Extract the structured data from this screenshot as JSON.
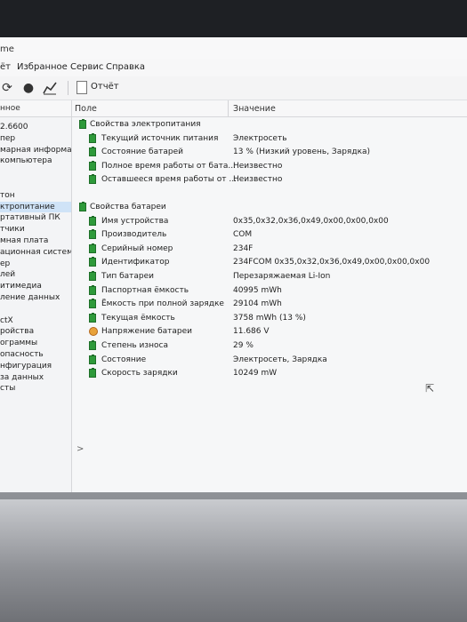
{
  "window": {
    "title_fragment": "me"
  },
  "menu": [
    "ёт",
    "Избранное",
    "Сервис",
    "Справка"
  ],
  "toolbar": {
    "report_label": "Отчёт",
    "icons": [
      "refresh-icon",
      "user-icon",
      "chart-icon"
    ]
  },
  "left_pane": {
    "header": "нное",
    "items": [
      {
        "label": "2.6600",
        "selected": false
      },
      {
        "label": "пер",
        "selected": false
      },
      {
        "label": "марная информац",
        "selected": false
      },
      {
        "label": "компьютера",
        "selected": false
      },
      {
        "label": "",
        "selected": false
      },
      {
        "label": "",
        "selected": false
      },
      {
        "label": "тон",
        "selected": false
      },
      {
        "label": "ктропитание",
        "selected": true
      },
      {
        "label": "ртативный ПК",
        "selected": false
      },
      {
        "label": "тчики",
        "selected": false
      },
      {
        "label": "мная плата",
        "selected": false
      },
      {
        "label": "ационная система",
        "selected": false
      },
      {
        "label": "ер",
        "selected": false
      },
      {
        "label": "лей",
        "selected": false
      },
      {
        "label": "итимедиа",
        "selected": false
      },
      {
        "label": "ление данных",
        "selected": false
      },
      {
        "label": "",
        "selected": false
      },
      {
        "label": "ctX",
        "selected": false
      },
      {
        "label": "ройства",
        "selected": false
      },
      {
        "label": "ограммы",
        "selected": false
      },
      {
        "label": "опасность",
        "selected": false
      },
      {
        "label": "нфигурация",
        "selected": false
      },
      {
        "label": "за данных",
        "selected": false
      },
      {
        "label": "сты",
        "selected": false
      }
    ],
    "scroll_arrow": ">"
  },
  "columns": {
    "field": "Поле",
    "value": "Значение"
  },
  "power_properties": {
    "title": "Свойства электропитания",
    "rows": [
      {
        "field": "Текущий источник питания",
        "value": "Электросеть"
      },
      {
        "field": "Состояние батарей",
        "value": "13 % (Низкий уровень, Зарядка)"
      },
      {
        "field": "Полное время работы от бата...",
        "value": "Неизвестно"
      },
      {
        "field": "Оставшееся время работы от ...",
        "value": "Неизвестно"
      }
    ]
  },
  "battery_properties": {
    "title": "Свойства батареи",
    "rows": [
      {
        "field": "Имя устройства",
        "value": "0x35,0x32,0x36,0x49,0x00,0x00,0x00",
        "icon": "battery"
      },
      {
        "field": "Производитель",
        "value": "COM",
        "icon": "battery"
      },
      {
        "field": "Серийный номер",
        "value": "234F",
        "icon": "battery"
      },
      {
        "field": "Идентификатор",
        "value": "234FCOM 0x35,0x32,0x36,0x49,0x00,0x00,0x00",
        "icon": "battery"
      },
      {
        "field": "Тип батареи",
        "value": "Перезаряжаемая Li-Ion",
        "icon": "battery"
      },
      {
        "field": "Паспортная ёмкость",
        "value": "40995 mWh",
        "icon": "battery"
      },
      {
        "field": "Ёмкость при полной зарядке",
        "value": "29104 mWh",
        "icon": "battery"
      },
      {
        "field": "Текущая ёмкость",
        "value": "3758 mWh  (13 %)",
        "icon": "battery"
      },
      {
        "field": "Напряжение батареи",
        "value": "11.686 V",
        "icon": "voltage"
      },
      {
        "field": "Степень износа",
        "value": "29 %",
        "icon": "battery"
      },
      {
        "field": "Состояние",
        "value": "Электросеть, Зарядка",
        "icon": "battery"
      },
      {
        "field": "Скорость зарядки",
        "value": "10249 mW",
        "icon": "battery"
      }
    ]
  },
  "colors": {
    "selection": "#cfe3f7",
    "battery_icon": "#2e9a3a",
    "voltage_icon": "#e8a23a"
  }
}
